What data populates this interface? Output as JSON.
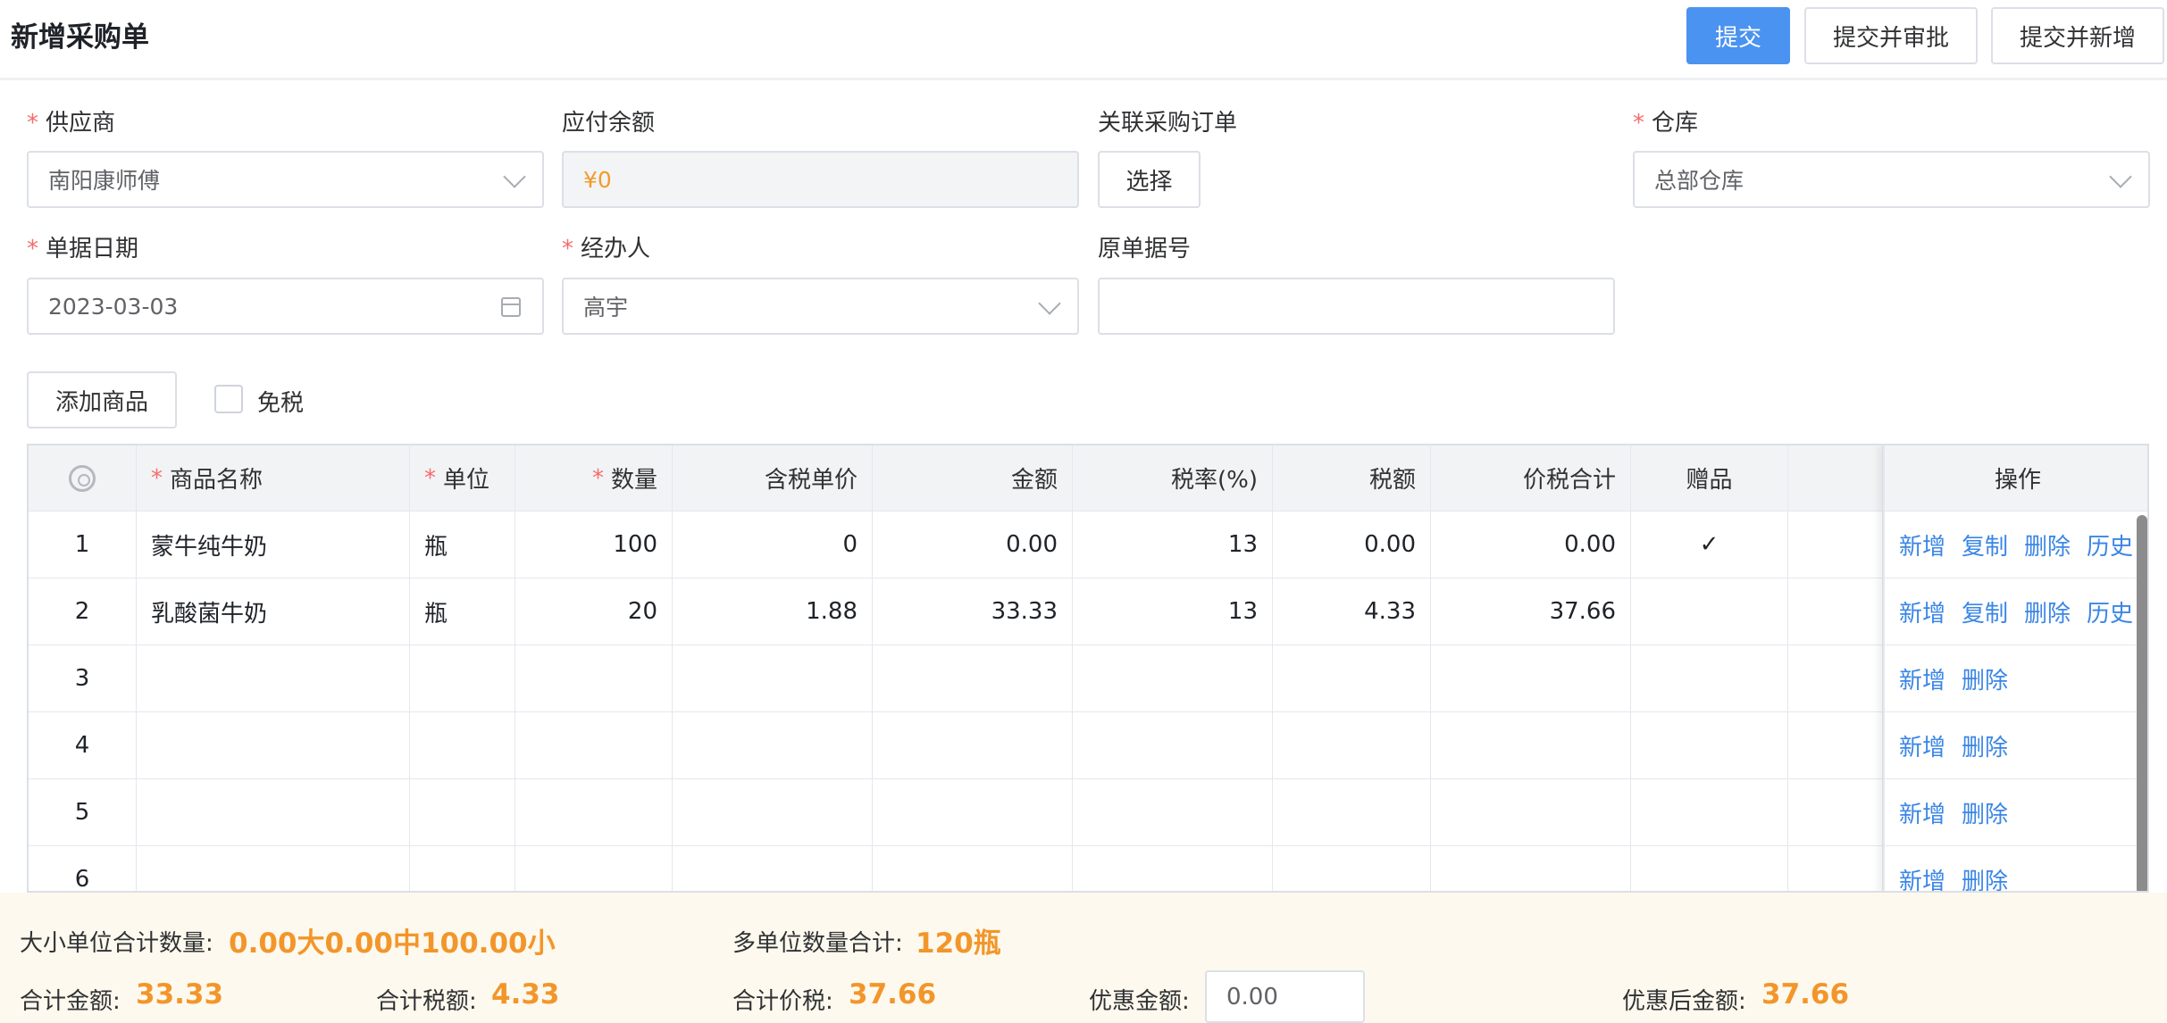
{
  "header": {
    "title": "新增采购单",
    "submit_label": "提交",
    "submit_approve_label": "提交并审批",
    "submit_new_label": "提交并新增"
  },
  "form": {
    "supplier_label": "供应商",
    "supplier_value": "南阳康师傅",
    "payable_label": "应付余额",
    "payable_value": "¥0",
    "linked_order_label": "关联采购订单",
    "linked_order_button": "选择",
    "warehouse_label": "仓库",
    "warehouse_value": "总部仓库",
    "date_label": "单据日期",
    "date_value": "2023-03-03",
    "handler_label": "经办人",
    "handler_value": "高宇",
    "orig_no_label": "原单据号",
    "orig_no_value": "",
    "required_mark": "*"
  },
  "toolbar": {
    "add_goods_label": "添加商品",
    "tax_free_label": "免税",
    "tax_free_checked": false
  },
  "table": {
    "headers": {
      "name": "商品名称",
      "unit": "单位",
      "qty": "数量",
      "price": "含税单价",
      "amount": "金额",
      "tax_rate": "税率(%)",
      "tax": "税额",
      "total": "价税合计",
      "gift": "赠品",
      "ops": "操作"
    },
    "rows": [
      {
        "no": "1",
        "name": "蒙牛纯牛奶",
        "unit": "瓶",
        "qty": "100",
        "price": "0",
        "amount": "0.00",
        "tax_rate": "13",
        "tax": "0.00",
        "total": "0.00",
        "gift": "✓"
      },
      {
        "no": "2",
        "name": "乳酸菌牛奶",
        "unit": "瓶",
        "qty": "20",
        "price": "1.88",
        "amount": "33.33",
        "tax_rate": "13",
        "tax": "4.33",
        "total": "37.66",
        "gift": ""
      },
      {
        "no": "3",
        "name": "",
        "unit": "",
        "qty": "",
        "price": "",
        "amount": "",
        "tax_rate": "",
        "tax": "",
        "total": "",
        "gift": ""
      },
      {
        "no": "4",
        "name": "",
        "unit": "",
        "qty": "",
        "price": "",
        "amount": "",
        "tax_rate": "",
        "tax": "",
        "total": "",
        "gift": ""
      },
      {
        "no": "5",
        "name": "",
        "unit": "",
        "qty": "",
        "price": "",
        "amount": "",
        "tax_rate": "",
        "tax": "",
        "total": "",
        "gift": ""
      },
      {
        "no": "6",
        "name": "",
        "unit": "",
        "qty": "",
        "price": "",
        "amount": "",
        "tax_rate": "",
        "tax": "",
        "total": "",
        "gift": ""
      }
    ],
    "ops": {
      "add": "新增",
      "copy": "复制",
      "delete": "删除",
      "history": "历史"
    }
  },
  "footer": {
    "unit_qty_label": "大小单位合计数量:",
    "unit_qty_value": "0.00大0.00中100.00小",
    "multi_qty_label": "多单位数量合计:",
    "multi_qty_value": "120瓶",
    "total_amount_label": "合计金额:",
    "total_amount_value": "33.33",
    "total_tax_label": "合计税额:",
    "total_tax_value": "4.33",
    "total_with_tax_label": "合计价税:",
    "total_with_tax_value": "37.66",
    "discount_label": "优惠金额:",
    "discount_value": "0.00",
    "after_discount_label": "优惠后金额:",
    "after_discount_value": "37.66"
  },
  "colors": {
    "primary": "#4b93f0",
    "link": "#3a86e6",
    "accent_orange": "#f2962b",
    "required": "#f56c6c"
  }
}
